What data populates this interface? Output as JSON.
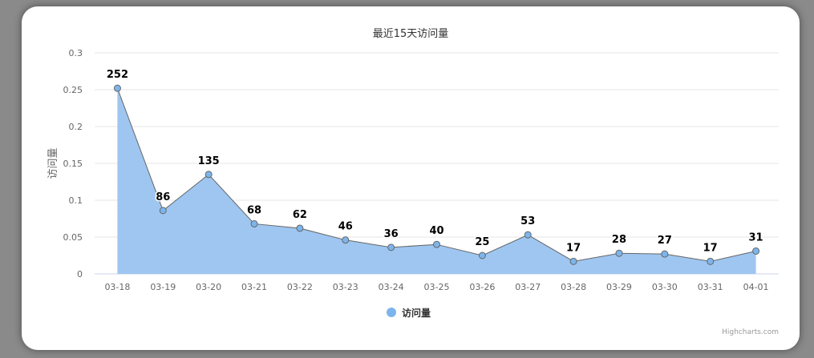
{
  "chart_data": {
    "type": "area",
    "title": "最近15天访问量",
    "ylabel": "访问量",
    "y_ticks": [
      "0",
      "0.05",
      "0.1",
      "0.15",
      "0.2",
      "0.25",
      "0.3"
    ],
    "ylim": [
      0,
      0.3
    ],
    "categories": [
      "03-18",
      "03-19",
      "03-20",
      "03-21",
      "03-22",
      "03-23",
      "03-24",
      "03-25",
      "03-26",
      "03-27",
      "03-28",
      "03-29",
      "03-30",
      "03-31",
      "04-01"
    ],
    "series": [
      {
        "name": "访问量",
        "values": [
          0.252,
          0.086,
          0.135,
          0.068,
          0.062,
          0.046,
          0.036,
          0.04,
          0.025,
          0.053,
          0.017,
          0.028,
          0.027,
          0.017,
          0.031
        ],
        "labels": [
          "252",
          "86",
          "135",
          "68",
          "62",
          "46",
          "36",
          "40",
          "25",
          "53",
          "17",
          "28",
          "27",
          "17",
          "31"
        ]
      }
    ],
    "grid": true,
    "legend_position": "bottom-center",
    "colors": {
      "fill": "#9ec6f0",
      "line": "#666666",
      "marker": "#7cb5ec"
    }
  },
  "credits": "Highcharts.com"
}
